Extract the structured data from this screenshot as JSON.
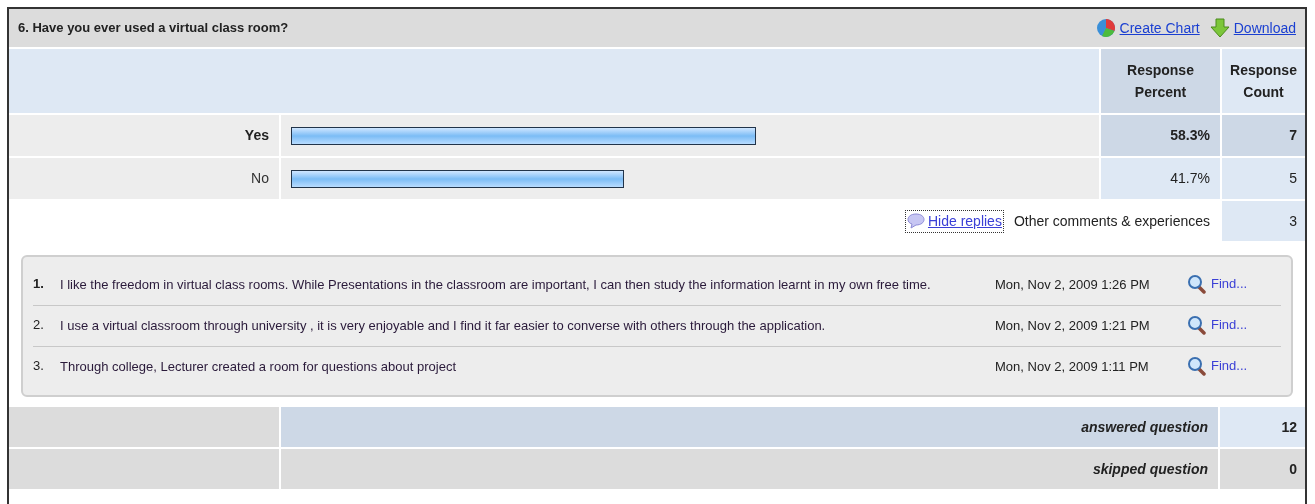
{
  "question": {
    "title": "6. Have you ever used a virtual class room?",
    "actions": [
      {
        "kind": "chart",
        "label": "Create Chart"
      },
      {
        "kind": "download",
        "label": "Download"
      }
    ]
  },
  "columns": [
    "Response Percent",
    "Response Count"
  ],
  "answers": [
    {
      "label": "Yes",
      "highlighted": true,
      "percent": "58.3%",
      "count": "7"
    },
    {
      "label": "No",
      "highlighted": false,
      "percent": "41.7%",
      "count": "5"
    }
  ],
  "other": {
    "toggle": "Hide replies",
    "expanded": true,
    "label": "Other comments & experiences",
    "count": "3"
  },
  "replies": [
    {
      "number": "1.",
      "text": "I like the freedom in virtual class rooms. While Presentations in the classroom are important, I can then study the information learnt in my own free time.",
      "date": "Mon, Nov 2, 2009 1:26 PM",
      "find": "Find..."
    },
    {
      "number": "2.",
      "text": "I use a virtual classroom through university , it is very enjoyable and I find it far easier to converse with others through the application.",
      "date": "Mon, Nov 2, 2009 1:21 PM",
      "find": "Find..."
    },
    {
      "number": "3.",
      "text": "Through college, Lecturer created a room for questions about project",
      "date": "Mon, Nov 2, 2009 1:11 PM",
      "find": "Find..."
    }
  ],
  "summary": [
    {
      "kind": "answered",
      "label": "answered question",
      "value": "12"
    },
    {
      "kind": "skipped",
      "label": "skipped question",
      "value": "0"
    }
  ]
}
